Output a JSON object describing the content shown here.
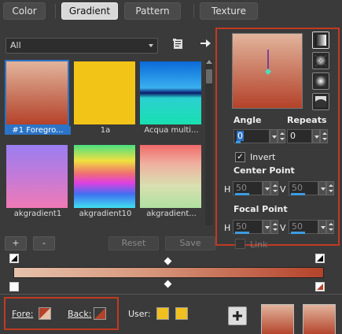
{
  "tabs": [
    {
      "label": "Color"
    },
    {
      "label": "Gradient"
    },
    {
      "label": "Pattern"
    },
    {
      "label": "Texture"
    }
  ],
  "category": {
    "selected": "All"
  },
  "gallery": {
    "items": [
      {
        "label": "#1 Foregro...",
        "selected": true
      },
      {
        "label": "1a"
      },
      {
        "label": "Acqua multi..."
      },
      {
        "label": "akgradient1"
      },
      {
        "label": "akgradient10"
      },
      {
        "label": "akgradient..."
      }
    ]
  },
  "settings": {
    "angle_label": "Angle",
    "angle_value": "0",
    "repeats_label": "Repeats",
    "repeats_value": "0",
    "invert_label": "Invert",
    "invert_checked": true,
    "center_label": "Center Point",
    "center_h_label": "H",
    "center_h": "50",
    "center_v_label": "V",
    "center_v": "50",
    "focal_label": "Focal Point",
    "focal_h_label": "H",
    "focal_h": "50",
    "focal_v_label": "V",
    "focal_v": "50",
    "link_label": "Link"
  },
  "editor": {
    "add_label": "+",
    "remove_label": "-",
    "reset_label": "Reset",
    "save_label": "Save"
  },
  "footer": {
    "fore_label": "Fore:",
    "back_label": "Back:",
    "user_label": "User:"
  },
  "colors": {
    "accent": "#2c74c7",
    "highlight_box": "#c03a22",
    "gradient_start": "#e6c2ab",
    "gradient_end": "#b4422a",
    "user_swatch": "#f0c020"
  }
}
